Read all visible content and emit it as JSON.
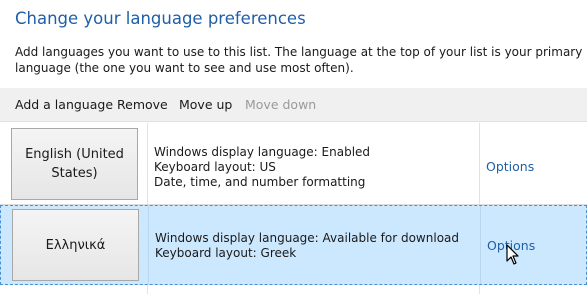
{
  "header": {
    "title": "Change your language preferences",
    "description": "Add languages you want to use to this list. The language at the top of your list is your primary language (the one you want to see and use most often)."
  },
  "toolbar": {
    "add_label": "Add a language",
    "remove_label": "Remove",
    "move_up_label": "Move up",
    "move_down_label": "Move down"
  },
  "languages": [
    {
      "name": "English (United States)",
      "details": [
        "Windows display language: Enabled",
        "Keyboard layout: US",
        "Date, time, and number formatting"
      ],
      "options_label": "Options",
      "selected": false
    },
    {
      "name": "Ελληνικά",
      "details": [
        "Windows display language: Available for download",
        "Keyboard layout: Greek"
      ],
      "options_label": "Options",
      "selected": true
    }
  ],
  "colors": {
    "title": "#1f5fa8",
    "link": "#1f5fa8",
    "selected_row": "#cce8ff",
    "toolbar_bg": "#f0f0f0",
    "disabled_text": "#9a9a9a"
  },
  "icons": {
    "cursor": "mouse-pointer-icon"
  }
}
